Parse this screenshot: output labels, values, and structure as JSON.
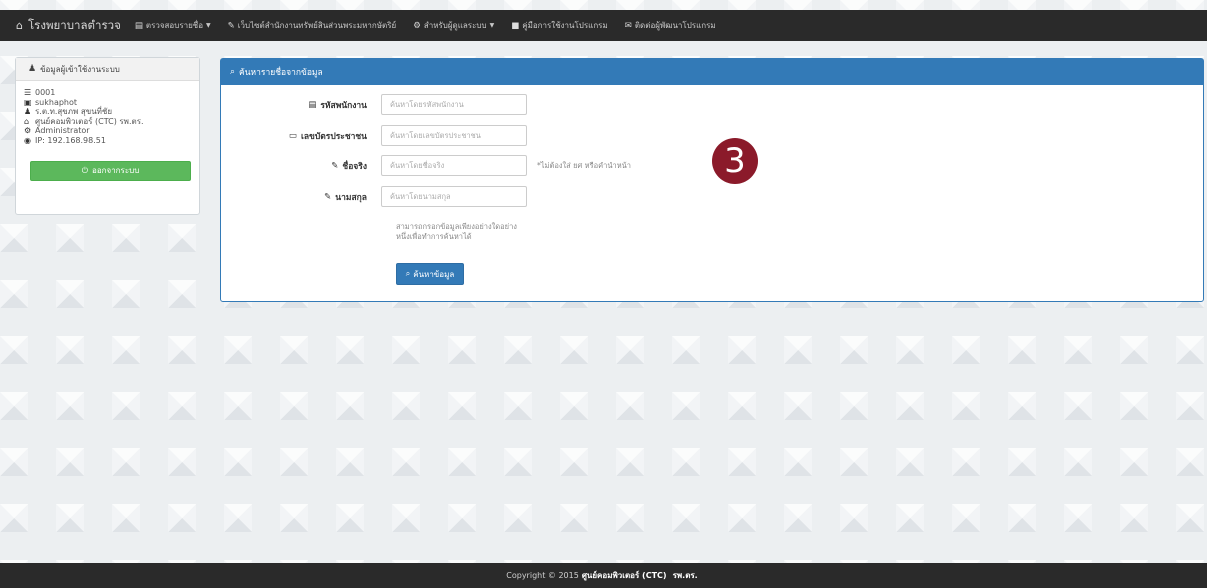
{
  "nav": {
    "brand": "โรงพยาบาลตำรวจ",
    "items": [
      {
        "label": "ตรวจสอบรายชื่อ",
        "icon": "folder-open-icon",
        "dropdown": true
      },
      {
        "label": "เว็บไซต์สำนักงานทรัพย์สินส่วนพระมหากษัตริย์",
        "icon": "pencil-icon",
        "dropdown": false
      },
      {
        "label": "สำหรับผู้ดูแลระบบ",
        "icon": "gear-icon",
        "dropdown": true
      },
      {
        "label": "คู่มือการใช้งานโปรแกรม",
        "icon": "file-icon",
        "dropdown": false
      },
      {
        "label": "ติดต่อผู้พัฒนาโปรแกรม",
        "icon": "envelope-icon",
        "dropdown": false
      }
    ]
  },
  "user_panel": {
    "title": "ข้อมูลผู้เข้าใช้งานระบบ",
    "id": "0001",
    "username": "sukhaphot",
    "name": "ร.ต.ท.สุขภพ สุขนที่ชัย",
    "department": "ศูนย์คอมพิวเตอร์ (CTC) รพ.ตร.",
    "role": "Administrator",
    "ip": "IP: 192.168.98.51",
    "logout_label": "ออกจากระบบ"
  },
  "search_panel": {
    "title": "ค้นหารายชื่อจากข้อมูล",
    "fields": [
      {
        "label": "รหัสพนักงาน",
        "icon": "id-card-icon",
        "placeholder": "ค้นหาโดยรหัสพนักงาน",
        "hint": ""
      },
      {
        "label": "เลขบัตรประชาชน",
        "icon": "credit-card-icon",
        "placeholder": "ค้นหาโดยเลขบัตรประชาชน",
        "hint": ""
      },
      {
        "label": "ชื่อจริง",
        "icon": "edit-icon",
        "placeholder": "ค้นหาโดยชื่อจริง",
        "hint": "*ไม่ต้องใส่ ยศ หรือคำนำหน้า"
      },
      {
        "label": "นามสกุล",
        "icon": "edit-icon",
        "placeholder": "ค้นหาโดยนามสกุล",
        "hint": ""
      }
    ],
    "note_line1": "สามารถกรอกข้อมูลเพียงอย่างใดอย่าง",
    "note_line2": "หนึ่งเพื่อทำการค้นหาได้",
    "search_button": "ค้นหาข้อมูล"
  },
  "step_badge": "3",
  "footer": {
    "prefix": "Copyright © 2015",
    "org": "ศูนย์คอมพิวเตอร์ (CTC)",
    "suffix": "รพ.ตร."
  }
}
